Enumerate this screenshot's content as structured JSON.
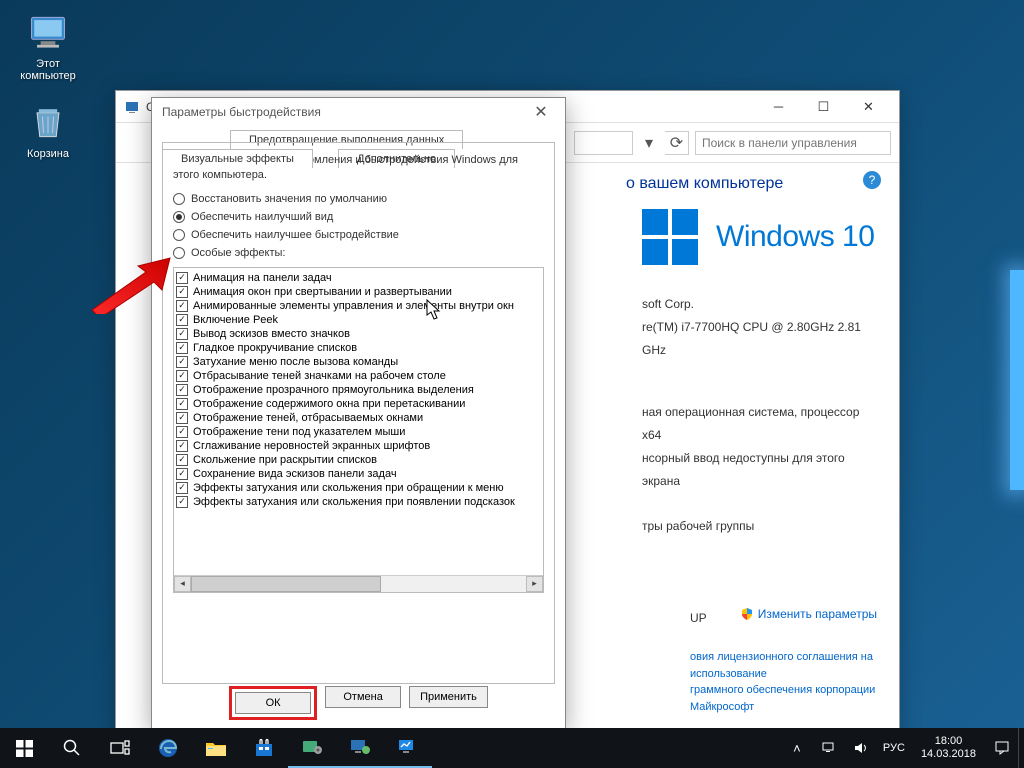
{
  "desktop": {
    "icons": [
      {
        "label": "Этот компьютер"
      },
      {
        "label": "Корзина"
      }
    ]
  },
  "control_panel": {
    "title_prefix": "Свой",
    "search_placeholder": "Поиск в панели управления",
    "heading_suffix": "о вашем компьютере",
    "os_brand": "Windows 10",
    "manufacturer_suffix": "soft Corp.",
    "cpu_suffix": "re(TM) i7-7700HQ CPU @ 2.80GHz   2.81 GHz",
    "system_type_suffix": "ная операционная система, процессор x64",
    "pen_touch_suffix": "нсорный ввод недоступны для этого экрана",
    "workgroup_label_suffix": "тры рабочей группы",
    "workgroup_value": "UP",
    "change_params": "Изменить параметры",
    "license_line1": "овия лицензионного соглашения на использование",
    "license_line2": "граммного обеспечения корпорации Майкрософт"
  },
  "perf_dialog": {
    "title": "Параметры быстродействия",
    "tabs": {
      "dep": "Предотвращение выполнения данных",
      "visual": "Визуальные эффекты",
      "advanced": "Дополнительно"
    },
    "description": "Выберите параметры оформления и быстродействия Windows для этого компьютера.",
    "radios": [
      {
        "label": "Восстановить значения по умолчанию",
        "checked": false
      },
      {
        "label": "Обеспечить наилучший вид",
        "checked": true
      },
      {
        "label": "Обеспечить наилучшее быстродействие",
        "checked": false
      },
      {
        "label": "Особые эффекты:",
        "checked": false
      }
    ],
    "checks": [
      "Анимация на панели задач",
      "Анимация окон при свертывании и развертывании",
      "Анимированные элементы управления и элементы внутри окн",
      "Включение Peek",
      "Вывод эскизов вместо значков",
      "Гладкое прокручивание списков",
      "Затухание меню после вызова команды",
      "Отбрасывание теней значками на рабочем столе",
      "Отображение прозрачного прямоугольника выделения",
      "Отображение содержимого окна при перетаскивании",
      "Отображение теней, отбрасываемых окнами",
      "Отображение тени под указателем мыши",
      "Сглаживание неровностей экранных шрифтов",
      "Скольжение при раскрытии списков",
      "Сохранение вида эскизов панели задач",
      "Эффекты затухания или скольжения при обращении к меню",
      "Эффекты затухания или скольжения при появлении подсказок"
    ],
    "buttons": {
      "ok": "ОК",
      "cancel": "Отмена",
      "apply": "Применить"
    }
  },
  "taskbar": {
    "lang": "РУС",
    "time": "18:00",
    "date": "14.03.2018"
  }
}
